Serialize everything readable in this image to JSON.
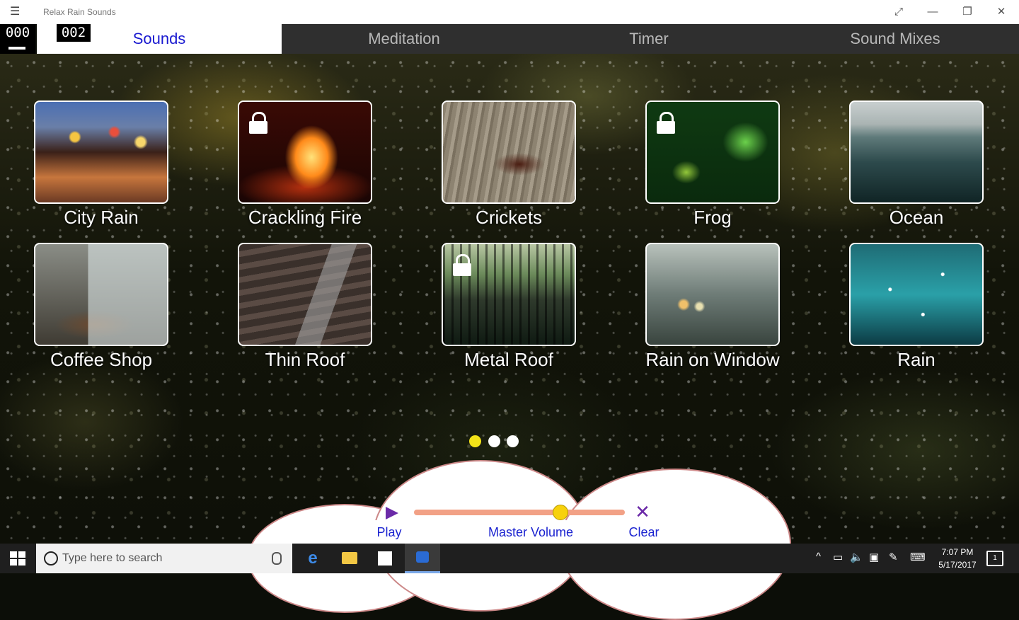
{
  "window": {
    "title": "Relax Rain Sounds",
    "controls": {
      "fullscreen": "⤢",
      "minimize": "—",
      "restore": "❐",
      "close": "✕"
    }
  },
  "counters": {
    "left": "000",
    "right": "002"
  },
  "tabs": [
    {
      "label": "Sounds",
      "active": true
    },
    {
      "label": "Meditation",
      "active": false
    },
    {
      "label": "Timer",
      "active": false
    },
    {
      "label": "Sound Mixes",
      "active": false
    }
  ],
  "sounds": [
    {
      "label": "City Rain",
      "locked": false
    },
    {
      "label": "Crackling Fire",
      "locked": true
    },
    {
      "label": "Crickets",
      "locked": false
    },
    {
      "label": "Frog",
      "locked": true
    },
    {
      "label": "Ocean",
      "locked": false
    },
    {
      "label": "Coffee Shop",
      "locked": false
    },
    {
      "label": "Thin Roof",
      "locked": false
    },
    {
      "label": "Metal Roof",
      "locked": true
    },
    {
      "label": "Rain on Window",
      "locked": false
    },
    {
      "label": "Rain",
      "locked": false
    }
  ],
  "pager": {
    "count": 3,
    "active_index": 0
  },
  "player": {
    "play_label": "Play",
    "volume_label": "Master Volume",
    "clear_label": "Clear",
    "volume_level": 0.69
  },
  "colors": {
    "active_tab_text": "#1a1ad0",
    "active_dot": "#f3e318",
    "slider_track": "#f2a186",
    "slider_knob": "#f7d10c",
    "icon_purple": "#6b2aa8"
  },
  "taskbar": {
    "search_placeholder": "Type here to search",
    "time": "7:07 PM",
    "date": "5/17/2017",
    "notification_count": "1"
  }
}
